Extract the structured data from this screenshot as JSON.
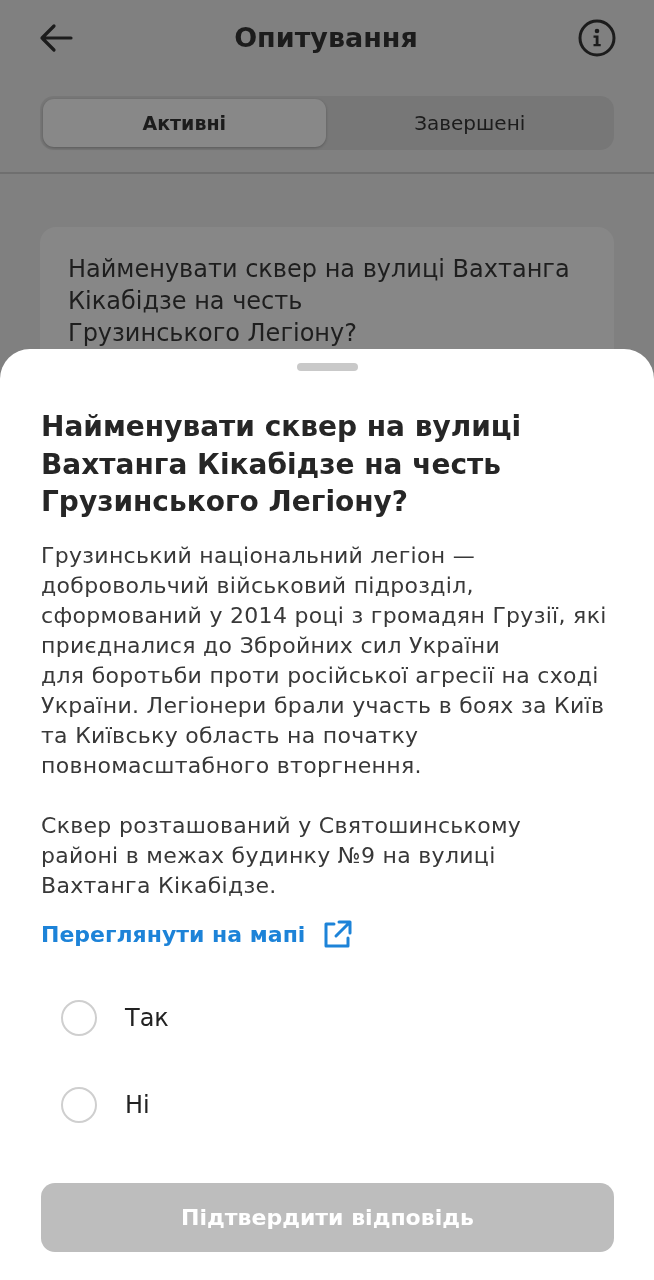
{
  "app_bar": {
    "title": "Опитування"
  },
  "tabs": [
    {
      "label": "Активні",
      "selected": true
    },
    {
      "label": "Завершені",
      "selected": false
    }
  ],
  "poll_card": {
    "question": "Найменувати сквер на вулиці Вахтанга Кікабідзе на честь Грузинського Легіону?"
  },
  "sheet": {
    "title": "Найменувати сквер на вулиці Вахтанга Кікабідзе на честь Грузинського Легіону?",
    "paragraphs": [
      "Грузинський національний легіон — добровольчий військовий підрозділ, сформований у 2014 році з громадян Грузії, які приєдналися до Збройних сил України для боротьби проти російської агресії на сході України. Легіонери брали участь в боях за Київ та Київську область на початку повномасштабного вторгнення.",
      "Сквер розташований у Святошинському районі в межах будинку №9 на вулиці Вахтанга Кікабідзе."
    ],
    "map_link": "Переглянути на мапі",
    "options": [
      {
        "label": "Так",
        "selected": false
      },
      {
        "label": "Ні",
        "selected": false
      }
    ],
    "submit": {
      "label": "Підтвердити відповідь",
      "disabled": true
    }
  }
}
